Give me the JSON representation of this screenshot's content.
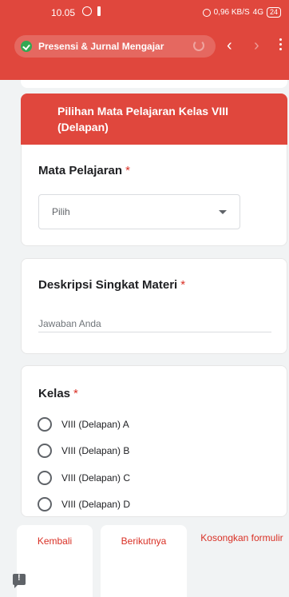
{
  "status_bar": {
    "time": "10.05",
    "network": "0,96 KB/S",
    "signal": "4G",
    "battery": "24"
  },
  "browser": {
    "page_title": "Presensi & Jurnal Mengajar"
  },
  "form": {
    "section_title": "Pilihan Mata Pelajaran Kelas VIII (Delapan)",
    "required_mark": "*",
    "subject_question": {
      "title": "Mata Pelajaran",
      "selected": "Pilih"
    },
    "description_question": {
      "title": "Deskripsi Singkat Materi",
      "placeholder": "Jawaban Anda"
    },
    "class_question": {
      "title": "Kelas",
      "options": [
        "VIII (Delapan) A",
        "VIII (Delapan) B",
        "VIII (Delapan) C",
        "VIII (Delapan) D"
      ]
    }
  },
  "footer": {
    "back_label": "Kembali",
    "next_label": "Berikutnya",
    "clear_label": "Kosongkan formulir"
  },
  "colors": {
    "theme": "#e0473d",
    "required": "#d93025",
    "secure": "#34a853"
  }
}
